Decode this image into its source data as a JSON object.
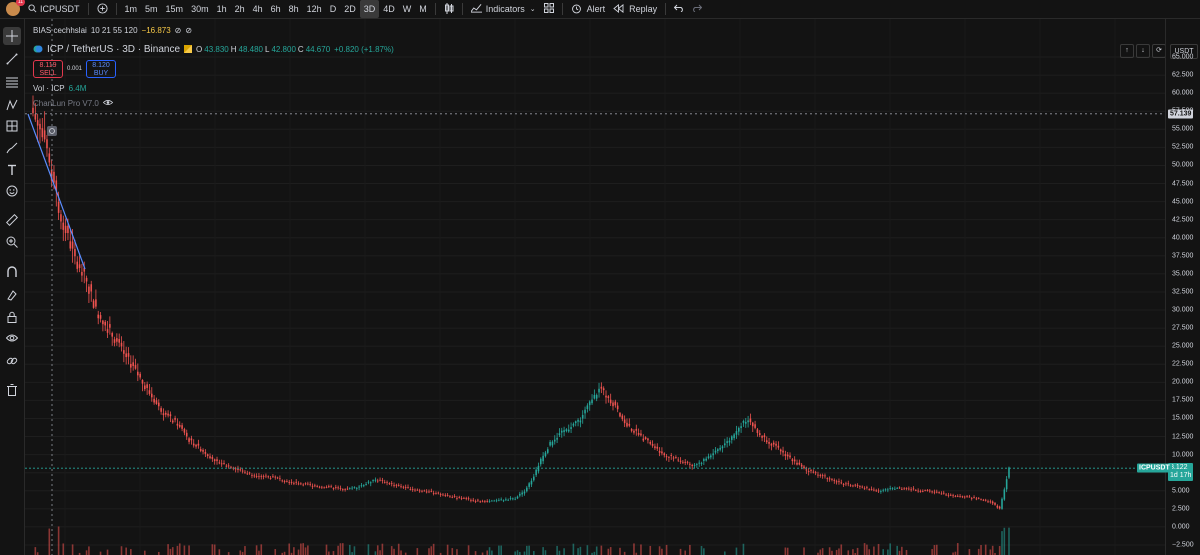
{
  "topbar": {
    "avatar_badge": "11",
    "symbol": "ICPUSDT",
    "intervals": [
      "1m",
      "5m",
      "15m",
      "30m",
      "1h",
      "2h",
      "4h",
      "6h",
      "8h",
      "12h",
      "D",
      "2D",
      "3D",
      "4D",
      "W",
      "M"
    ],
    "active_interval": "3D",
    "indicators_label": "Indicators",
    "alert_label": "Alert",
    "replay_label": "Replay"
  },
  "legend": {
    "bias": {
      "name": "BIAS cechhslai",
      "params": "10 21 55 120",
      "value": "−16.873"
    },
    "title": "ICP / TetherUS · 3D · Binance",
    "ohlc": [
      {
        "label": "O",
        "value": "43.830"
      },
      {
        "label": "H",
        "value": "48.480"
      },
      {
        "label": "L",
        "value": "42.800"
      },
      {
        "label": "C",
        "value": "44.670"
      }
    ],
    "change": "+0.820 (+1.87%)",
    "sell": {
      "price": "8.119",
      "label": "SELL"
    },
    "buy": {
      "price": "8.120",
      "label": "BUY"
    },
    "spread": "0.001",
    "vol": {
      "label": "Vol · ICP",
      "value": "6.4M"
    },
    "indicator": "ChanLun Pro V7.0"
  },
  "axis": {
    "currency": "USDT",
    "ticks": [
      "65.000",
      "62.500",
      "60.000",
      "57.500",
      "55.000",
      "52.500",
      "50.000",
      "47.500",
      "45.000",
      "42.500",
      "40.000",
      "37.500",
      "35.000",
      "32.500",
      "30.000",
      "27.500",
      "25.000",
      "22.500",
      "20.000",
      "17.500",
      "15.000",
      "12.500",
      "10.000",
      "7.500",
      "5.000",
      "2.500",
      "0.000",
      "−2.500"
    ],
    "crosshair_price": "57.139",
    "current_symbol": "ICPUSDT",
    "current_price": "8.122",
    "countdown": "1d 17h"
  },
  "colors": {
    "up": "#26a69a",
    "down": "#ef5350",
    "tag_bg": "#26a69a",
    "bg": "#131313"
  },
  "chart_data": {
    "type": "candlestick",
    "price_axis": {
      "min": -2.5,
      "max": 65,
      "unit": "USDT"
    },
    "closes_approx": [
      55,
      50,
      44,
      40,
      36,
      34,
      30,
      28,
      26,
      24,
      22,
      20,
      18,
      16,
      15,
      14,
      12,
      11,
      10,
      9,
      8.5,
      8,
      7.5,
      7.2,
      7,
      6.8,
      6.5,
      6.2,
      6,
      5.8,
      5.6,
      5.5,
      5.4,
      5.2,
      5.5,
      6,
      6.5,
      6.2,
      5.8,
      5.5,
      5.2,
      5,
      4.8,
      4.5,
      4.2,
      4,
      3.8,
      3.6,
      3.5,
      3.6,
      3.8,
      4,
      5,
      7,
      10,
      12,
      13,
      14,
      15,
      17,
      19,
      18,
      16,
      14,
      13,
      12,
      11,
      10,
      9.5,
      9,
      8.5,
      9,
      10,
      11,
      12,
      14,
      15,
      13,
      12,
      11,
      10,
      9,
      8,
      7.5,
      7,
      6.5,
      6,
      5.8,
      5.5,
      5.3,
      5,
      5.2,
      5.4,
      5.3,
      5.1,
      5,
      4.8,
      4.6,
      4.4,
      4.2,
      4,
      3.8,
      3.5,
      2.5,
      8.1
    ]
  }
}
